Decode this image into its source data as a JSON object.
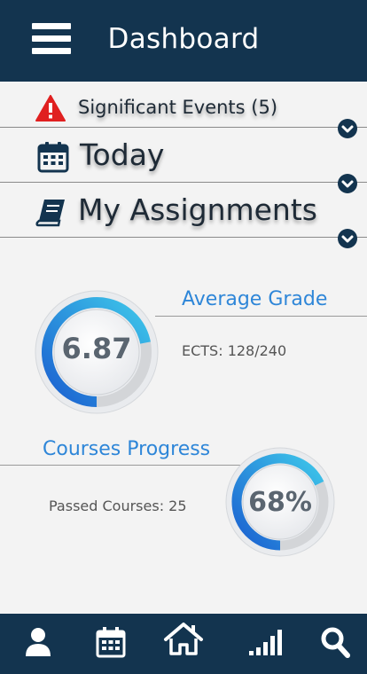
{
  "header": {
    "title": "Dashboard",
    "menu_icon": "hamburger-menu-icon"
  },
  "sections": [
    {
      "id": "significant-events",
      "label": "Significant Events",
      "count": "(5)",
      "icon": "warning-icon"
    },
    {
      "id": "today",
      "label": "Today",
      "icon": "calendar-icon"
    },
    {
      "id": "my-assignments",
      "label": "My Assignments",
      "icon": "book-icon"
    }
  ],
  "stats": {
    "average_grade": {
      "title": "Average Grade",
      "value": "6.87",
      "detail": "ECTS: 128/240",
      "fill_fraction": 0.72
    },
    "courses_progress": {
      "title": "Courses Progress",
      "value": "68%",
      "detail": "Passed Courses: 25",
      "fill_fraction": 0.68
    }
  },
  "bottom_nav": [
    {
      "id": "profile",
      "icon": "user-icon"
    },
    {
      "id": "calendar",
      "icon": "calendar-icon"
    },
    {
      "id": "home",
      "icon": "home-icon"
    },
    {
      "id": "stats",
      "icon": "signal-bars-icon"
    },
    {
      "id": "search",
      "icon": "search-icon"
    }
  ],
  "colors": {
    "header": "#13344f",
    "accent": "#2e86d8",
    "warning": "#e02020",
    "gauge_start": "#1a5fd0",
    "gauge_end": "#3ec7ea"
  }
}
